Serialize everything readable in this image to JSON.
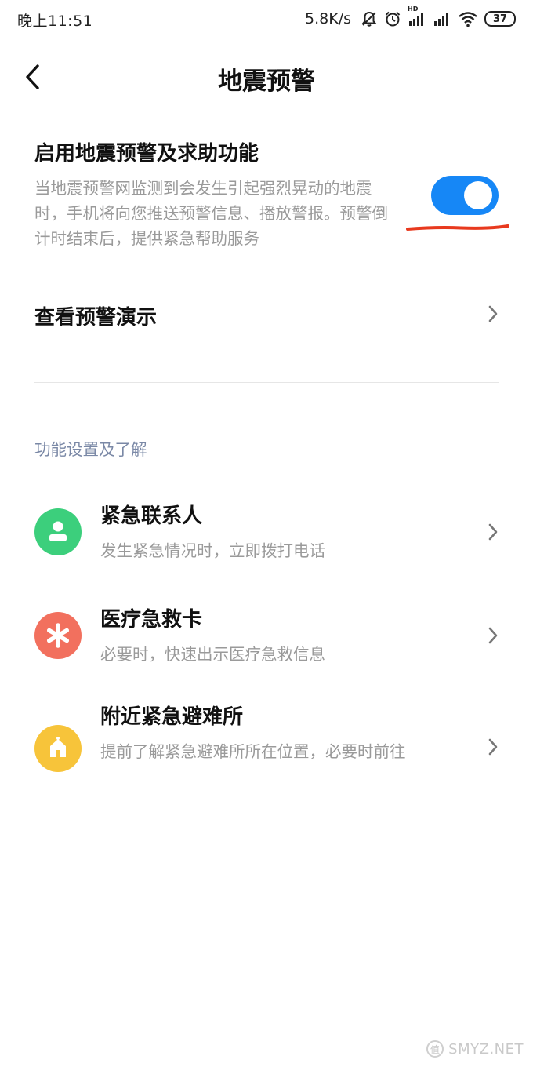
{
  "status_bar": {
    "time": "晚上11:51",
    "net_speed": "5.8K/s",
    "battery": "37",
    "hd_label": "HD",
    "icons": [
      "mute-bell-icon",
      "alarm-icon",
      "signal-hd-icon",
      "signal-icon",
      "wifi-icon",
      "battery-icon"
    ]
  },
  "header": {
    "title": "地震预警",
    "back_icon": "chevron-left-icon"
  },
  "earthquake_toggle": {
    "title": "启用地震预警及求助功能",
    "description": "当地震预警网监测到会发生引起强烈晃动的地震时，手机将向您推送预警信息、播放警报。预警倒计时结束后，提供紧急帮助服务",
    "enabled": true,
    "accent_color": "#1687f6",
    "annotation_color": "#e8391e"
  },
  "demo": {
    "label": "查看预警演示"
  },
  "section": {
    "header": "功能设置及了解"
  },
  "features": [
    {
      "title": "紧急联系人",
      "subtitle": "发生紧急情况时，立即拨打电话",
      "icon": "person-icon",
      "color": "#3ccf7c"
    },
    {
      "title": "医疗急救卡",
      "subtitle": "必要时，快速出示医疗急救信息",
      "icon": "asterisk-icon",
      "color": "#f2705e"
    },
    {
      "title": "附近紧急避难所",
      "subtitle": "提前了解紧急避难所所在位置，必要时前往",
      "icon": "shelter-icon",
      "color": "#f7c43a"
    }
  ],
  "watermark": {
    "text": "SMYZ.NET",
    "mark": "值"
  }
}
